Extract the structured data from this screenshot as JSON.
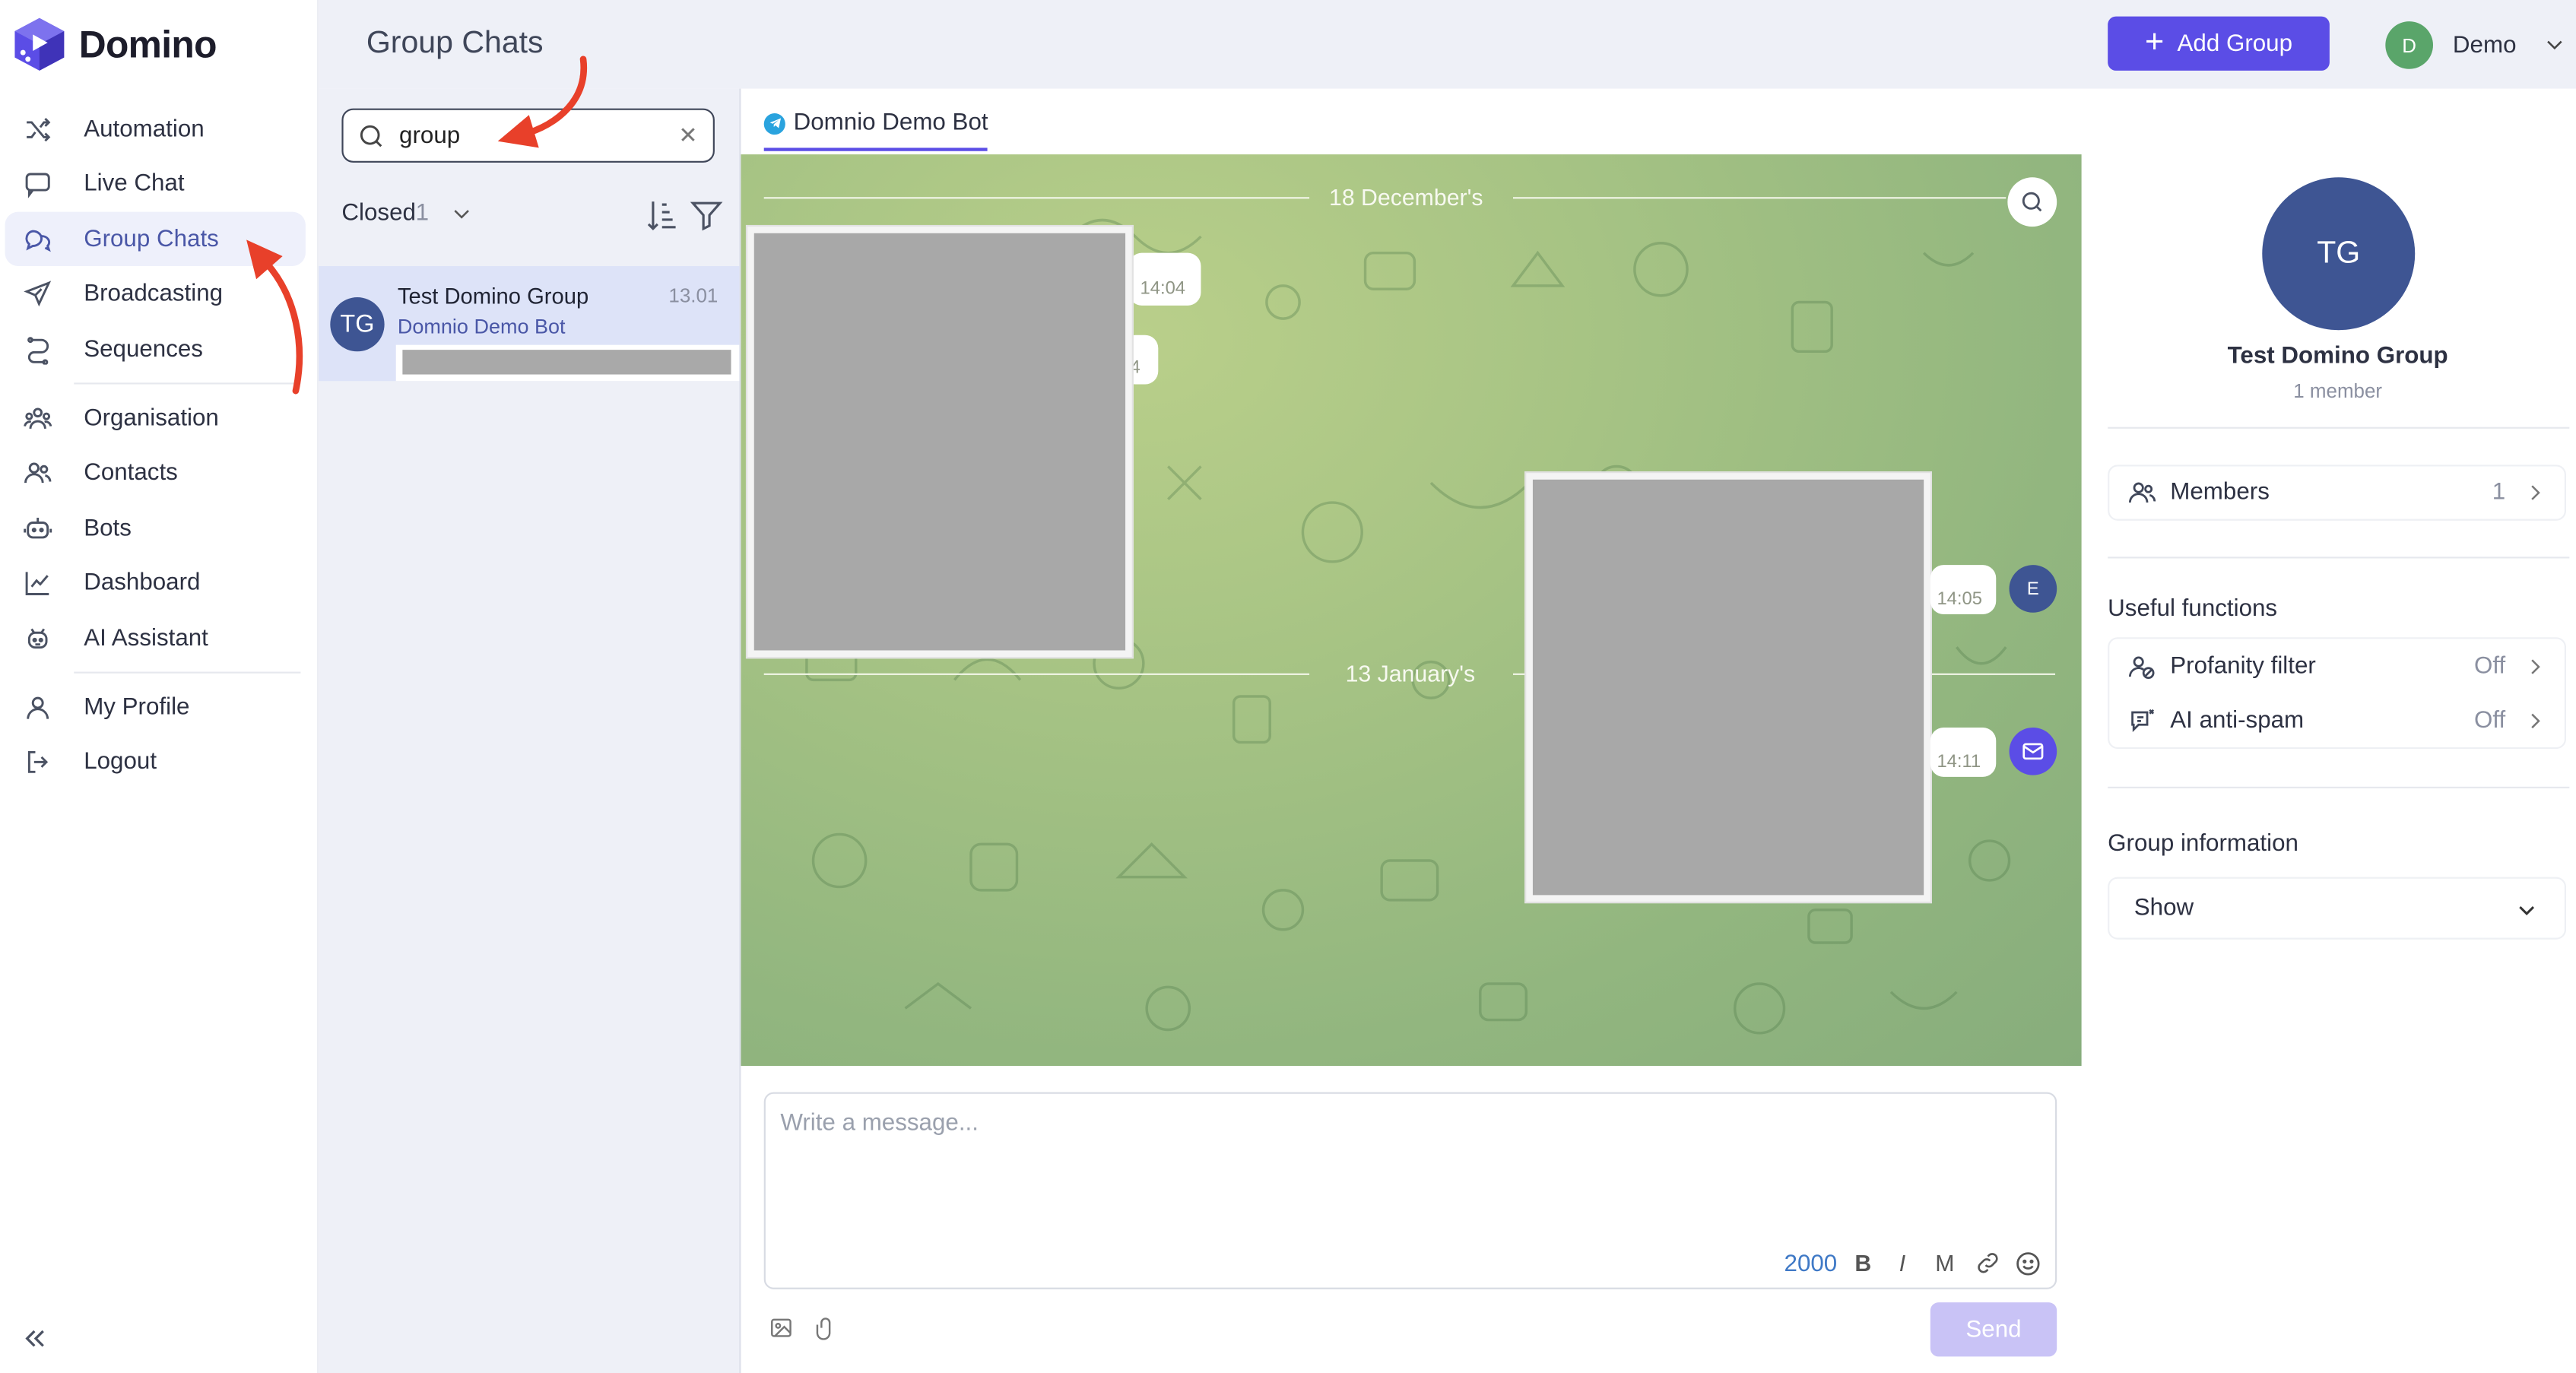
{
  "app": {
    "brand": "Domino",
    "page_title": "Group Chats",
    "accent_color": "#5b4de6"
  },
  "sidebar": {
    "items": [
      {
        "label": "Automation",
        "icon": "shuffle-icon"
      },
      {
        "label": "Live Chat",
        "icon": "chat-bubble-icon"
      },
      {
        "label": "Group Chats",
        "icon": "group-chat-icon",
        "active": true
      },
      {
        "label": "Broadcasting",
        "icon": "paper-plane-icon"
      },
      {
        "label": "Sequences",
        "icon": "sequence-icon"
      },
      {
        "label": "Organisation",
        "icon": "organisation-icon"
      },
      {
        "label": "Contacts",
        "icon": "contacts-icon"
      },
      {
        "label": "Bots",
        "icon": "bot-icon"
      },
      {
        "label": "Dashboard",
        "icon": "chart-line-icon"
      },
      {
        "label": "AI Assistant",
        "icon": "ai-assistant-icon"
      },
      {
        "label": "My Profile",
        "icon": "user-icon"
      },
      {
        "label": "Logout",
        "icon": "logout-icon"
      }
    ]
  },
  "header": {
    "add_group_label": "Add Group",
    "user_initial": "D",
    "user_name": "Demo"
  },
  "chat_list": {
    "search_value": "group",
    "filter_label": "Closed",
    "filter_count": "1",
    "items": [
      {
        "initials": "TG",
        "name": "Test Domino Group",
        "time": "13.01",
        "bot": "Domnio Demo Bot"
      }
    ]
  },
  "conversation": {
    "tab_label": "Domnio Demo Bot",
    "date_separators": [
      "18 December's",
      "13 January's"
    ],
    "messages": [
      {
        "time": "14:04"
      },
      {
        "time": "4"
      },
      {
        "time": "14:05"
      },
      {
        "time": "14:11"
      }
    ],
    "sender_initial": "E",
    "composer_placeholder": "Write a message...",
    "char_count": "2000",
    "format_bold": "B",
    "format_italic": "I",
    "format_mono": "M",
    "send_label": "Send"
  },
  "info_panel": {
    "initials": "TG",
    "group_name": "Test Domino Group",
    "member_count_text": "1 member",
    "members_label": "Members",
    "members_value": "1",
    "useful_functions_title": "Useful functions",
    "functions": [
      {
        "label": "Profanity filter",
        "value": "Off"
      },
      {
        "label": "AI anti-spam",
        "value": "Off"
      }
    ],
    "group_info_title": "Group information",
    "group_info_select": "Show"
  }
}
